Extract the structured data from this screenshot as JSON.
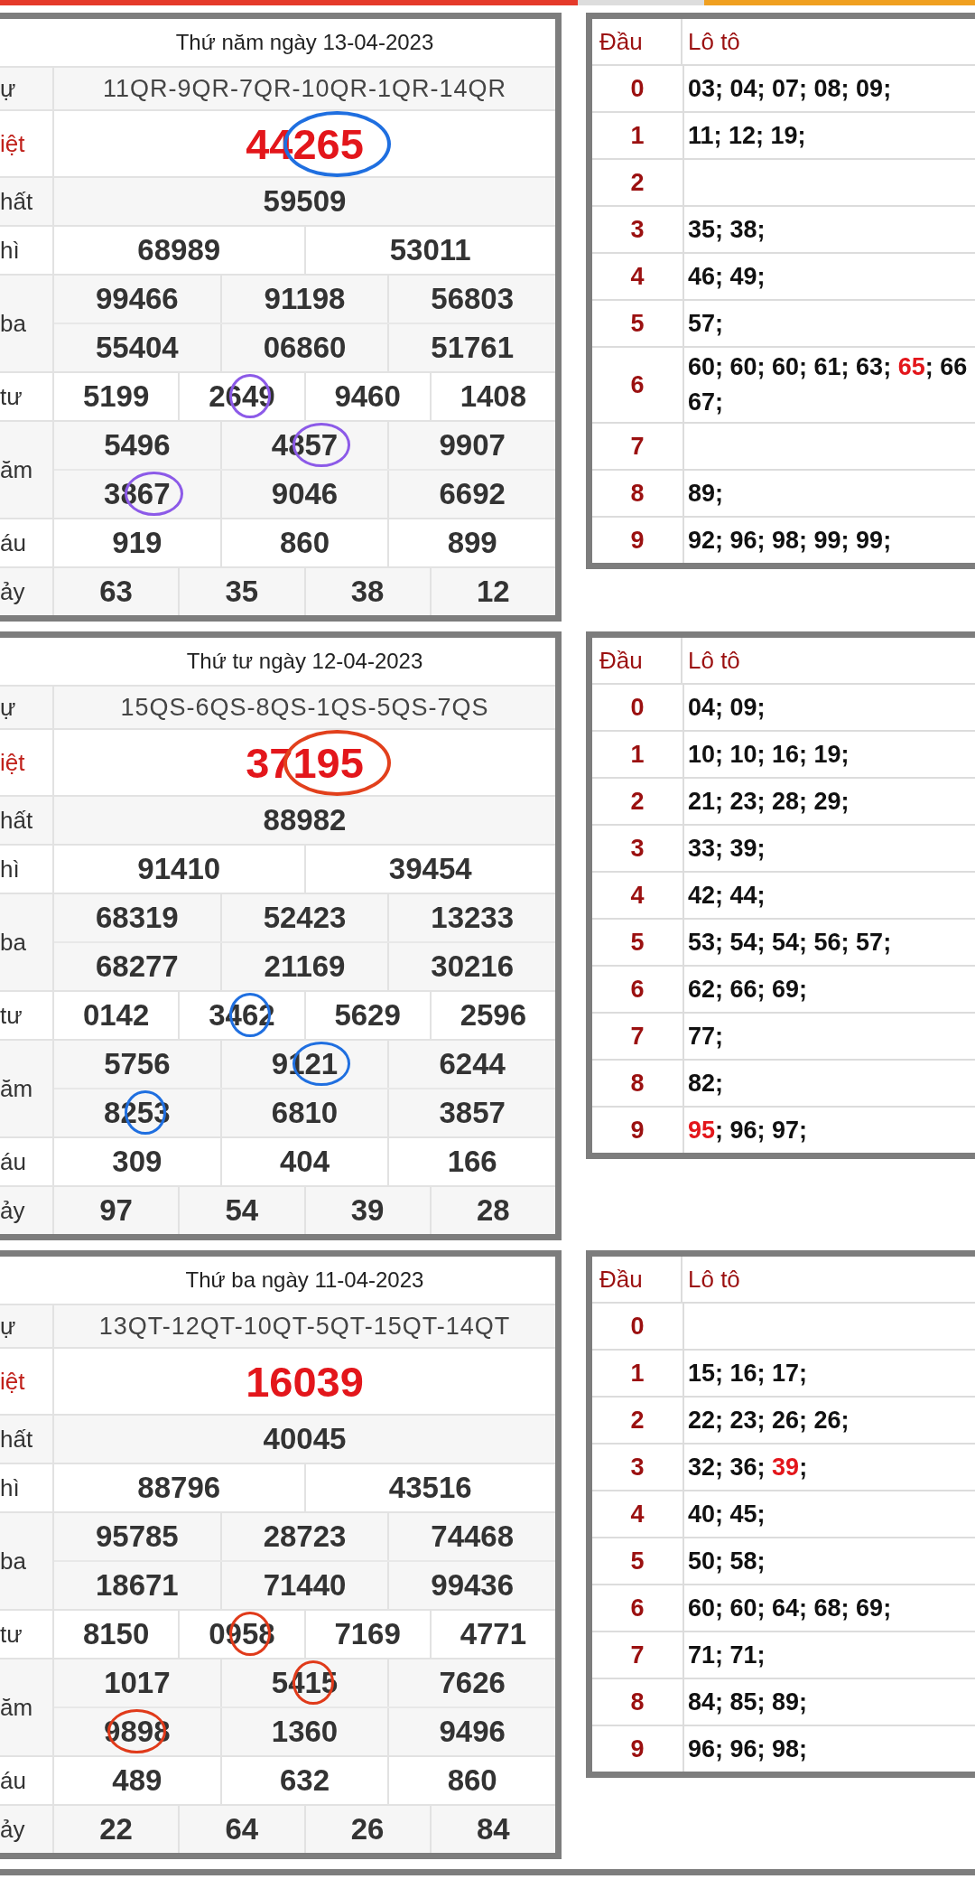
{
  "draws": [
    {
      "title": "Thứ năm ngày 13-04-2023",
      "rows": [
        {
          "kind": "codes",
          "label": "ự",
          "lines": [
            [
              {
                "text": "11QR-9QR-7QR-10QR-1QR-14QR"
              }
            ]
          ]
        },
        {
          "kind": "special",
          "label": "iệt",
          "lines": [
            [
              {
                "text": "44",
                "circled": "265",
                "color": "#1f6fe0"
              }
            ]
          ]
        },
        {
          "kind": "prize",
          "label": "hất",
          "lines": [
            [
              {
                "text": "59509"
              }
            ]
          ]
        },
        {
          "kind": "prize",
          "label": "hì",
          "lines": [
            [
              {
                "text": "68989"
              },
              {
                "text": "53011"
              }
            ]
          ]
        },
        {
          "kind": "prize",
          "label": "ba",
          "lines": [
            [
              {
                "text": "99466"
              },
              {
                "text": "91198"
              },
              {
                "text": "56803"
              }
            ],
            [
              {
                "text": "55404"
              },
              {
                "text": "06860"
              },
              {
                "text": "51761"
              }
            ]
          ]
        },
        {
          "kind": "prize",
          "label": "tư",
          "lines": [
            [
              {
                "text": "5199"
              },
              {
                "text": "26",
                "circled": "4",
                "post": "9",
                "color": "#8c5ae8"
              },
              {
                "text": "9460"
              },
              {
                "text": "1408"
              }
            ]
          ]
        },
        {
          "kind": "prize",
          "label": "ăm",
          "lines": [
            [
              {
                "text": "5496"
              },
              {
                "text": "48",
                "circled": "57",
                "color": "#8c5ae8"
              },
              {
                "text": "9907"
              }
            ],
            [
              {
                "text": "38",
                "circled": "67",
                "color": "#8c5ae8"
              },
              {
                "text": "9046"
              },
              {
                "text": "6692"
              }
            ]
          ]
        },
        {
          "kind": "prize",
          "label": "áu",
          "lines": [
            [
              {
                "text": "919"
              },
              {
                "text": "860"
              },
              {
                "text": "899"
              }
            ]
          ]
        },
        {
          "kind": "prize",
          "label": "ảy",
          "lines": [
            [
              {
                "text": "63"
              },
              {
                "text": "35"
              },
              {
                "text": "38"
              },
              {
                "text": "12"
              }
            ]
          ]
        }
      ],
      "loto": {
        "header": [
          "Đầu",
          "Lô tô"
        ],
        "rows": [
          {
            "head": "0",
            "lines": [
              [
                {
                  "text": "03; 04; 07; 08; 09;",
                  "hit": false
                }
              ]
            ]
          },
          {
            "head": "1",
            "lines": [
              [
                {
                  "text": "11; 12; 19;",
                  "hit": false
                }
              ]
            ]
          },
          {
            "head": "2"
          },
          {
            "head": "3",
            "lines": [
              [
                {
                  "text": "35; 38;",
                  "hit": false
                }
              ]
            ]
          },
          {
            "head": "4",
            "lines": [
              [
                {
                  "text": "46; 49;",
                  "hit": false
                }
              ]
            ]
          },
          {
            "head": "5",
            "lines": [
              [
                {
                  "text": "57;",
                  "hit": false
                }
              ]
            ]
          },
          {
            "head": "6",
            "lines": [
              [
                {
                  "text": "60; 60; 60; 61; 63;",
                  "hit": false
                },
                {
                  "text": "65",
                  "hit": true
                },
                {
                  "text": "; 66",
                  "hit": false
                }
              ],
              [
                {
                  "text": "67;",
                  "hit": false
                }
              ]
            ]
          },
          {
            "head": "7"
          },
          {
            "head": "8",
            "lines": [
              [
                {
                  "text": "89;",
                  "hit": false
                }
              ]
            ]
          },
          {
            "head": "9",
            "lines": [
              [
                {
                  "text": "92; 96; 98; 99; 99;",
                  "hit": false
                }
              ]
            ]
          }
        ]
      }
    },
    {
      "title": "Thứ tư ngày 12-04-2023",
      "rows": [
        {
          "kind": "codes",
          "label": "ự",
          "lines": [
            [
              {
                "text": "15QS-6QS-8QS-1QS-5QS-7QS"
              }
            ]
          ]
        },
        {
          "kind": "special",
          "label": "iệt",
          "lines": [
            [
              {
                "text": "37",
                "circled": "195",
                "color": "#e2401c"
              }
            ]
          ]
        },
        {
          "kind": "prize",
          "label": "hất",
          "lines": [
            [
              {
                "text": "88982"
              }
            ]
          ]
        },
        {
          "kind": "prize",
          "label": "hì",
          "lines": [
            [
              {
                "text": "91410"
              },
              {
                "text": "39454"
              }
            ]
          ]
        },
        {
          "kind": "prize",
          "label": "ba",
          "lines": [
            [
              {
                "text": "68319"
              },
              {
                "text": "52423"
              },
              {
                "text": "13233"
              }
            ],
            [
              {
                "text": "68277"
              },
              {
                "text": "21169"
              },
              {
                "text": "30216"
              }
            ]
          ]
        },
        {
          "kind": "prize",
          "label": "tư",
          "lines": [
            [
              {
                "text": "0142"
              },
              {
                "text": "34",
                "circled": "6",
                "post": "2",
                "color": "#1f6fe0"
              },
              {
                "text": "5629"
              },
              {
                "text": "2596"
              }
            ]
          ]
        },
        {
          "kind": "prize",
          "label": "ăm",
          "lines": [
            [
              {
                "text": "5756"
              },
              {
                "text": "91",
                "circled": "21",
                "color": "#1f6fe0"
              },
              {
                "text": "6244"
              }
            ],
            [
              {
                "text": "82",
                "circled": "5",
                "post": "3",
                "color": "#1f6fe0"
              },
              {
                "text": "6810"
              },
              {
                "text": "3857"
              }
            ]
          ]
        },
        {
          "kind": "prize",
          "label": "áu",
          "lines": [
            [
              {
                "text": "309"
              },
              {
                "text": "404"
              },
              {
                "text": "166"
              }
            ]
          ]
        },
        {
          "kind": "prize",
          "label": "ảy",
          "lines": [
            [
              {
                "text": "97"
              },
              {
                "text": "54"
              },
              {
                "text": "39"
              },
              {
                "text": "28"
              }
            ]
          ]
        }
      ],
      "loto": {
        "header": [
          "Đầu",
          "Lô tô"
        ],
        "rows": [
          {
            "head": "0",
            "lines": [
              [
                {
                  "text": "04; 09;",
                  "hit": false
                }
              ]
            ]
          },
          {
            "head": "1",
            "lines": [
              [
                {
                  "text": "10; 10; 16; 19;",
                  "hit": false
                }
              ]
            ]
          },
          {
            "head": "2",
            "lines": [
              [
                {
                  "text": "21; 23; 28; 29;",
                  "hit": false
                }
              ]
            ]
          },
          {
            "head": "3",
            "lines": [
              [
                {
                  "text": "33; 39;",
                  "hit": false
                }
              ]
            ]
          },
          {
            "head": "4",
            "lines": [
              [
                {
                  "text": "42; 44;",
                  "hit": false
                }
              ]
            ]
          },
          {
            "head": "5",
            "lines": [
              [
                {
                  "text": "53; 54; 54; 56; 57;",
                  "hit": false
                }
              ]
            ]
          },
          {
            "head": "6",
            "lines": [
              [
                {
                  "text": "62; 66; 69;",
                  "hit": false
                }
              ]
            ]
          },
          {
            "head": "7",
            "lines": [
              [
                {
                  "text": "77;",
                  "hit": false
                }
              ]
            ]
          },
          {
            "head": "8",
            "lines": [
              [
                {
                  "text": "82;",
                  "hit": false
                }
              ]
            ]
          },
          {
            "head": "9",
            "lines": [
              [
                {
                  "text": "95",
                  "hit": true
                },
                {
                  "text": "; 96; 97;",
                  "hit": false
                }
              ]
            ]
          }
        ]
      }
    },
    {
      "title": "Thứ ba ngày 11-04-2023",
      "rows": [
        {
          "kind": "codes",
          "label": "ự",
          "lines": [
            [
              {
                "text": "13QT-12QT-10QT-5QT-15QT-14QT"
              }
            ]
          ]
        },
        {
          "kind": "special",
          "label": "iệt",
          "lines": [
            [
              {
                "text": "16039"
              }
            ]
          ]
        },
        {
          "kind": "prize",
          "label": "hất",
          "lines": [
            [
              {
                "text": "40045"
              }
            ]
          ]
        },
        {
          "kind": "prize",
          "label": "hì",
          "lines": [
            [
              {
                "text": "88796"
              },
              {
                "text": "43516"
              }
            ]
          ]
        },
        {
          "kind": "prize",
          "label": "ba",
          "lines": [
            [
              {
                "text": "95785"
              },
              {
                "text": "28723"
              },
              {
                "text": "74468"
              }
            ],
            [
              {
                "text": "18671"
              },
              {
                "text": "71440"
              },
              {
                "text": "99436"
              }
            ]
          ]
        },
        {
          "kind": "prize",
          "label": "tư",
          "lines": [
            [
              {
                "text": "8150"
              },
              {
                "text": "09",
                "circled": "5",
                "post": "8",
                "color": "#e03a1a"
              },
              {
                "text": "7169"
              },
              {
                "text": "4771"
              }
            ]
          ]
        },
        {
          "kind": "prize",
          "label": "ăm",
          "lines": [
            [
              {
                "text": "1017"
              },
              {
                "text": "54",
                "circled": "1",
                "post": "5",
                "color": "#e03a1a"
              },
              {
                "text": "7626"
              }
            ],
            [
              {
                "text": "9",
                "circled": "89",
                "post": "8",
                "color": "#e03a1a"
              },
              {
                "text": "1360"
              },
              {
                "text": "9496"
              }
            ]
          ]
        },
        {
          "kind": "prize",
          "label": "áu",
          "lines": [
            [
              {
                "text": "489"
              },
              {
                "text": "632"
              },
              {
                "text": "860"
              }
            ]
          ]
        },
        {
          "kind": "prize",
          "label": "ảy",
          "lines": [
            [
              {
                "text": "22"
              },
              {
                "text": "64"
              },
              {
                "text": "26"
              },
              {
                "text": "84"
              }
            ]
          ]
        }
      ],
      "loto": {
        "header": [
          "Đầu",
          "Lô tô"
        ],
        "rows": [
          {
            "head": "0"
          },
          {
            "head": "1",
            "lines": [
              [
                {
                  "text": "15; 16; 17;",
                  "hit": false
                }
              ]
            ]
          },
          {
            "head": "2",
            "lines": [
              [
                {
                  "text": "22; 23; 26; 26;",
                  "hit": false
                }
              ]
            ]
          },
          {
            "head": "3",
            "lines": [
              [
                {
                  "text": "32; 36;",
                  "hit": false
                },
                {
                  "text": "39",
                  "hit": true
                },
                {
                  "text": ";",
                  "hit": false
                }
              ]
            ]
          },
          {
            "head": "4",
            "lines": [
              [
                {
                  "text": "40; 45;",
                  "hit": false
                }
              ]
            ]
          },
          {
            "head": "5",
            "lines": [
              [
                {
                  "text": "50; 58;",
                  "hit": false
                }
              ]
            ]
          },
          {
            "head": "6",
            "lines": [
              [
                {
                  "text": "60; 60; 64; 68; 69;",
                  "hit": false
                }
              ]
            ]
          },
          {
            "head": "7",
            "lines": [
              [
                {
                  "text": "71; 71;",
                  "hit": false
                }
              ]
            ]
          },
          {
            "head": "8",
            "lines": [
              [
                {
                  "text": "84; 85; 89;",
                  "hit": false
                }
              ]
            ]
          },
          {
            "head": "9",
            "lines": [
              [
                {
                  "text": "96; 96; 98;",
                  "hit": false
                }
              ]
            ]
          }
        ]
      }
    }
  ]
}
